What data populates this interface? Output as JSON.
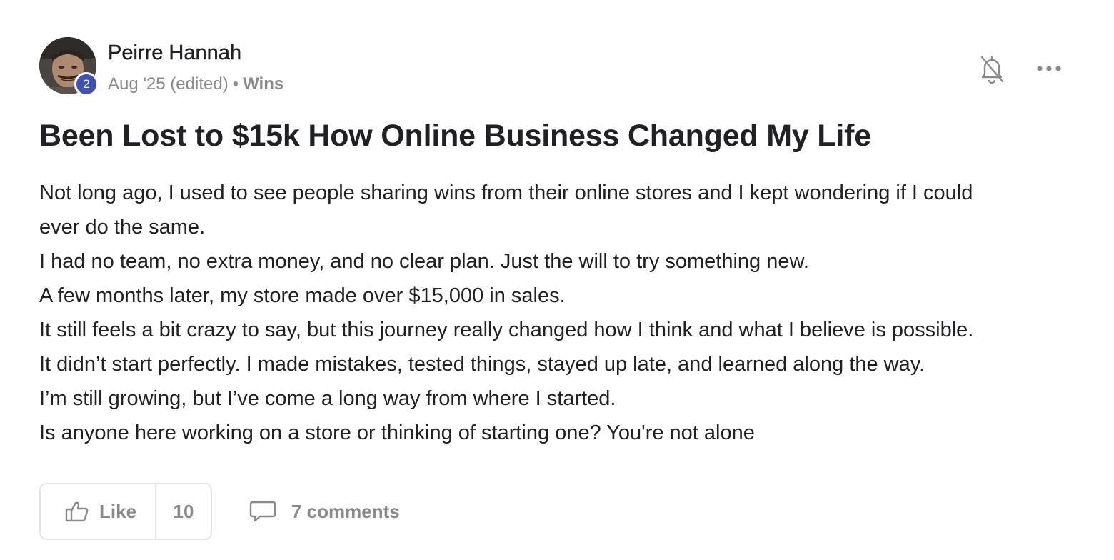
{
  "post": {
    "author": {
      "name": "Peirre Hannah",
      "level": "2"
    },
    "meta": {
      "date": "Aug '25 (edited)",
      "separator": "•",
      "category": "Wins"
    },
    "title": "Been Lost to $15k How Online Business Changed My Life",
    "body": [
      "Not long ago, I used to see people sharing wins from their online stores and I kept wondering if I could",
      "ever do the same.",
      "I had no team, no extra money, and no clear plan. Just the will to try something new.",
      "A few months later, my store made over $15,000 in sales.",
      "It still feels a bit crazy to say, but this journey really changed how I think and what I believe is possible.",
      "It didn’t start perfectly. I made mistakes, tested things, stayed up late, and learned along the way.",
      "I’m still growing, but I’ve come a long way from where I started.",
      "Is anyone here working on a store or thinking of starting one? You're not alone"
    ],
    "actions": {
      "like_label": "Like",
      "like_count": "10",
      "comments_label": "7 comments"
    },
    "icons": {
      "bell": "bell-off-icon",
      "more": "more-horizontal-icon",
      "thumb": "thumbs-up-icon",
      "comment": "comment-bubble-icon"
    },
    "colors": {
      "level_badge": "#3f51b5",
      "muted_text": "#8a8a8a",
      "primary_text": "#202124",
      "border": "#e4e4e4"
    }
  }
}
